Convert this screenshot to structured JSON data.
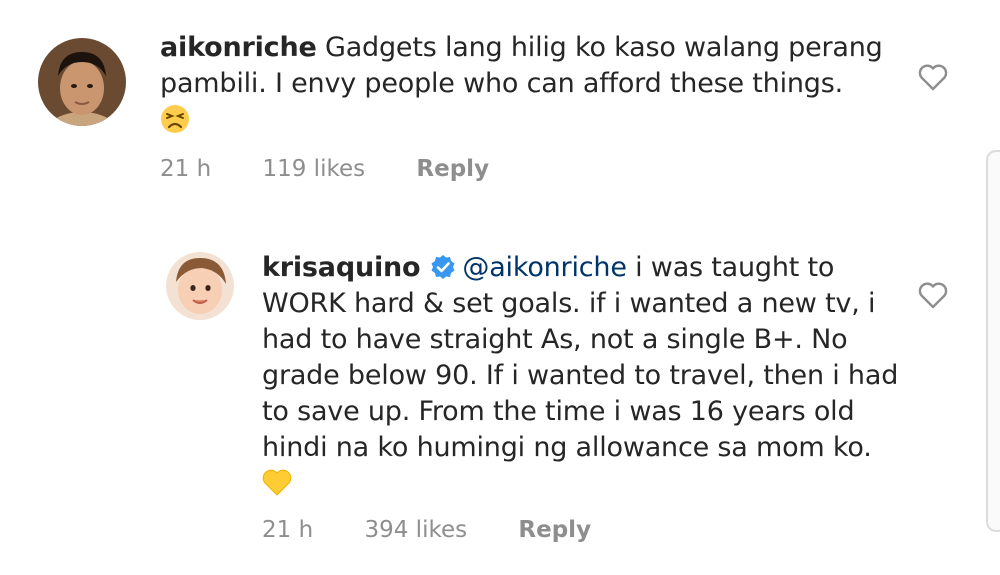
{
  "comments": [
    {
      "username": "aikonriche",
      "text": "Gadgets lang hilig ko kaso walang perang pambili. I envy people who can afford these things.",
      "emoji": "persevering-face",
      "time": "21 h",
      "likes": "119 likes",
      "reply_label": "Reply",
      "verified": false
    },
    {
      "username": "krisaquino",
      "mention": "@aikonriche",
      "text": "i was taught to WORK hard & set goals. if i wanted a new tv, i had to have straight As, not a single B+. No grade below 90. If i wanted to travel, then i had to save up. From the time i was 16 years old hindi na ko humingi ng allowance sa mom ko.",
      "emoji": "yellow-heart",
      "time": "21 h",
      "likes": "394 likes",
      "reply_label": "Reply",
      "verified": true
    }
  ],
  "colors": {
    "text": "#262626",
    "meta": "#8e8e8e",
    "mention": "#003569",
    "verified": "#3897f0"
  }
}
